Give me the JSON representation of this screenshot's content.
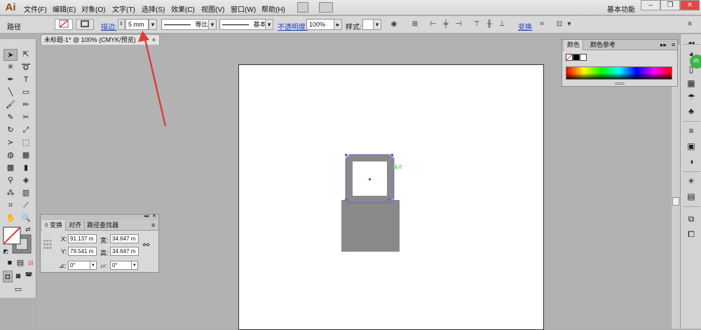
{
  "app": {
    "logo": "Ai",
    "workspace": "基本功能"
  },
  "menu": [
    "文件(F)",
    "编辑(E)",
    "对象(O)",
    "文字(T)",
    "选择(S)",
    "效果(C)",
    "视图(V)",
    "窗口(W)",
    "帮助(H)"
  ],
  "window_buttons": [
    "–",
    "❐",
    "✕"
  ],
  "control": {
    "object_type": "路径",
    "stroke_label": "描边:",
    "stroke_value": "5 mm",
    "profile1": "等比",
    "profile2": "基本",
    "opacity_label": "不透明度:",
    "opacity_value": "100%",
    "style_label": "样式:",
    "transform_link": "变换"
  },
  "document": {
    "tab": "未标题-1* @ 100% (CMYK/预览)",
    "close": "×"
  },
  "color_panel": {
    "tab1": "颜色",
    "tab2": "颜色参考"
  },
  "transform_panel": {
    "tabs": [
      "变换",
      "对齐",
      "路径查找器"
    ],
    "x_label": "X:",
    "x_value": "91.137 m",
    "y_label": "Y:",
    "y_value": "79.541 m",
    "w_label": "宽:",
    "w_value": "34.647 m",
    "h_label": "高:",
    "h_value": "34.647 m",
    "angle_value": "0°",
    "shear_value": "0°"
  },
  "canvas": {
    "anchor_label": "锚点"
  },
  "colors": {
    "stroke": "#8b888b",
    "selection": "#4a64c8",
    "accent_red": "#e03a3a",
    "anchor_green": "#4ec94e"
  }
}
